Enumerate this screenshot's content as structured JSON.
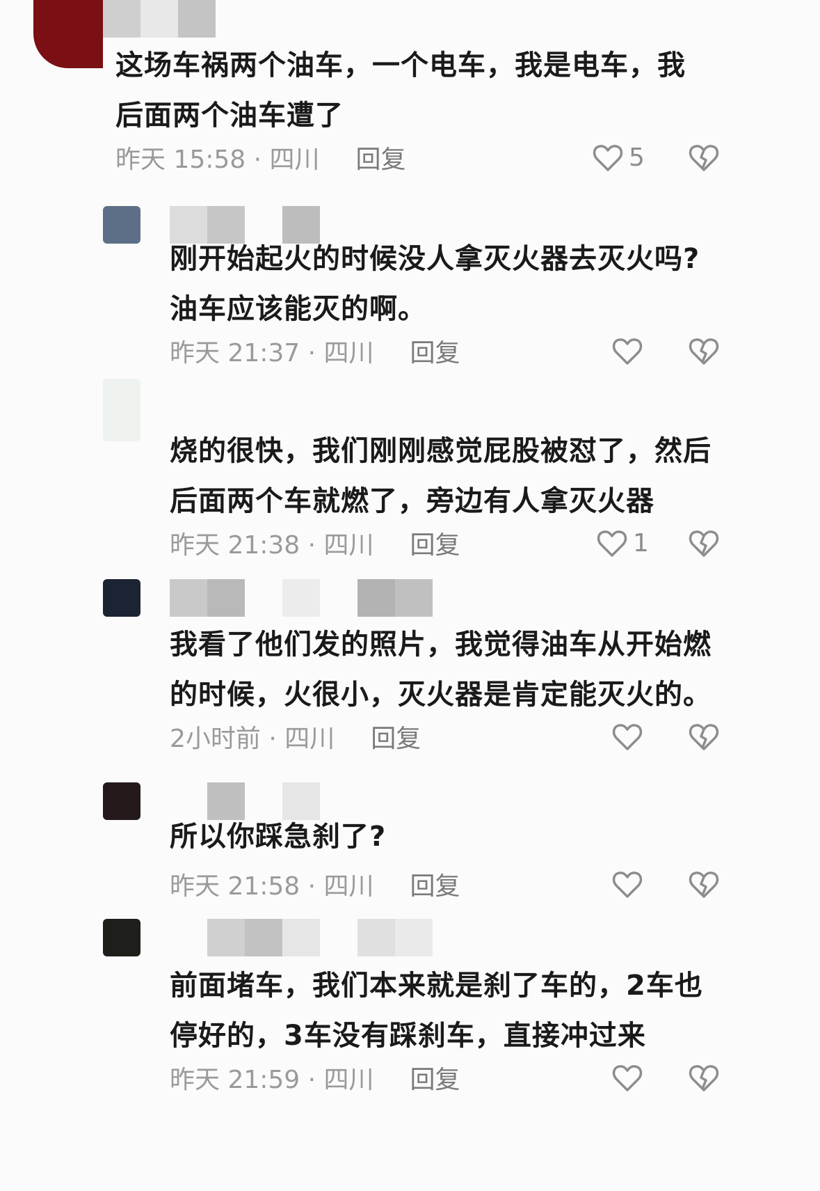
{
  "comments": [
    {
      "text": "这场车祸两个油车，一个电车，我是电车，我\n后面两个油车遭了",
      "time": "昨天 15:58 · 四川",
      "reply": "回复",
      "likes": "5",
      "avatar_color": "#7a0f14"
    },
    {
      "text": "刚开始起火的时候没人拿灭火器去灭火吗?\n油车应该能灭的啊。",
      "time": "昨天 21:37 · 四川",
      "reply": "回复",
      "likes": "",
      "avatar_color": "#5d6f86"
    },
    {
      "text": "烧的很快，我们刚刚感觉屁股被怼了，然后\n后面两个车就燃了，旁边有人拿灭火器",
      "time": "昨天 21:38 · 四川",
      "reply": "回复",
      "likes": "1",
      "avatar_color": "#eef2ef"
    },
    {
      "text": "我看了他们发的照片，我觉得油车从开始燃\n的时候，火很小，灭火器是肯定能灭火的。",
      "time": "2小时前 · 四川",
      "reply": "回复",
      "likes": "",
      "avatar_color": "#1c2433"
    },
    {
      "text": "所以你踩急刹了?",
      "time": "昨天 21:58 · 四川",
      "reply": "回复",
      "likes": "",
      "avatar_color": "#241a1c"
    },
    {
      "text": "前面堵车，我们本来就是刹了车的，2车也\n停好的，3车没有踩刹车，直接冲过来",
      "time": "昨天 21:59 · 四川",
      "reply": "回复",
      "likes": "",
      "avatar_color": "#1e1f1a"
    }
  ],
  "icons": {
    "like": "heart-outline-icon",
    "dislike": "broken-heart-icon"
  },
  "colors": {
    "text": "#1a1a1a",
    "meta": "#9a9a9a",
    "icon": "#8d8d8d"
  }
}
